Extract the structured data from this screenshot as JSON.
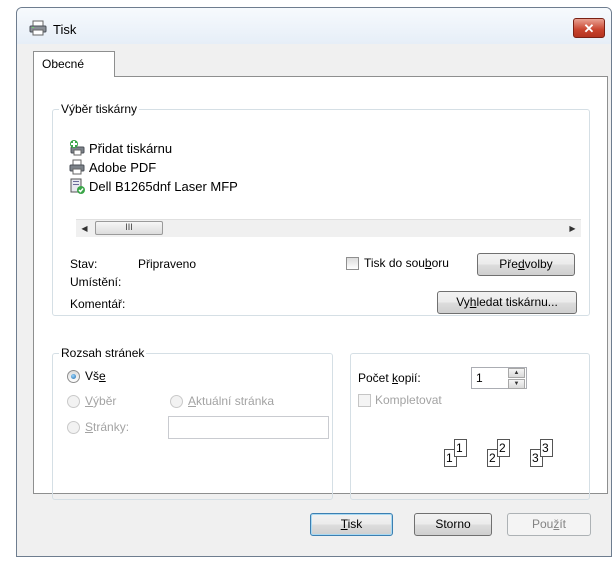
{
  "window": {
    "title": "Tisk",
    "close_label": "✕"
  },
  "tabs": [
    {
      "label": "Obecné",
      "selected": true
    }
  ],
  "printer_group": {
    "legend": "Výběr tiskárny",
    "printers": [
      {
        "name": "Přidat tiskárnu",
        "icon": "add-printer-icon"
      },
      {
        "name": "Adobe PDF",
        "icon": "printer-icon"
      },
      {
        "name": "Dell B1265dnf Laser MFP",
        "icon": "network-printer-icon"
      }
    ],
    "scroll_thumb_grip": "III",
    "status_label": "Stav:",
    "status_value": "Připraveno",
    "location_label": "Umístění:",
    "comment_label": "Komentář:",
    "print_to_file": {
      "label_pre": "Tisk do sou",
      "label_u": "b",
      "label_post": "oru",
      "checked": false
    },
    "preferences_button": {
      "pre": "Pře",
      "u": "d",
      "post": "volby"
    },
    "find_printer_button": {
      "pre": "Vy",
      "u": "h",
      "post": "ledat tiskárnu..."
    }
  },
  "range_group": {
    "legend": "Rozsah stránek",
    "all": {
      "pre": "Vš",
      "u": "e",
      "post": "",
      "checked": true
    },
    "selection": {
      "pre": "",
      "u": "V",
      "post": "ýběr",
      "enabled": false
    },
    "current_page": {
      "pre": "",
      "u": "A",
      "post": "ktuální stránka",
      "enabled": false
    },
    "pages": {
      "pre": "",
      "u": "S",
      "post": "tránky:",
      "enabled": false,
      "value": ""
    }
  },
  "copies_group": {
    "copies_label": {
      "pre": "Počet ",
      "u": "k",
      "post": "opií:"
    },
    "copies_value": "1",
    "collate": {
      "label": "Kompletovat",
      "enabled": false,
      "checked": false
    },
    "collate_digits": [
      "1",
      "1",
      "2",
      "2",
      "3",
      "3"
    ]
  },
  "buttons": {
    "print": {
      "pre": "",
      "u": "T",
      "post": "isk"
    },
    "cancel": {
      "label": "Storno"
    },
    "apply": {
      "pre": "Pou",
      "u": "ž",
      "post": "ít",
      "enabled": false
    }
  }
}
